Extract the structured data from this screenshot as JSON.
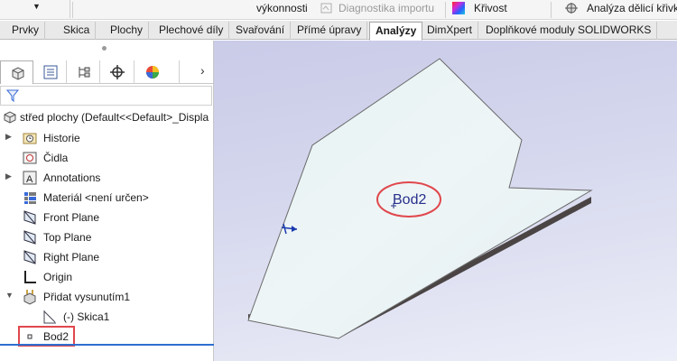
{
  "commandbar": {
    "items": [
      {
        "label": "výkonnosti",
        "disabled": false
      },
      {
        "label": "Diagnostika importu",
        "disabled": true
      },
      {
        "label": "Křivost",
        "disabled": false
      },
      {
        "label": "Analýza dělicí křivky",
        "disabled": false
      }
    ]
  },
  "tabs": [
    {
      "label": "Prvky",
      "active": false
    },
    {
      "label": "Skica",
      "active": false
    },
    {
      "label": "Plochy",
      "active": false
    },
    {
      "label": "Plechové díly",
      "active": false
    },
    {
      "label": "Svařování",
      "active": false
    },
    {
      "label": "Přímé úpravy",
      "active": false
    },
    {
      "label": "Analýzy",
      "active": true
    },
    {
      "label": "DimXpert",
      "active": false
    },
    {
      "label": "Doplňkové moduly SOLIDWORKS",
      "active": false
    }
  ],
  "panel": {
    "tab_icons": [
      "feature-manager-icon",
      "property-manager-icon",
      "configuration-manager-icon",
      "dimxpert-manager-icon",
      "display-manager-icon"
    ],
    "root_label": "střed plochy  (Default<<Default>_Displa",
    "tree": [
      {
        "label": "Historie",
        "icon": "history-folder-icon",
        "expandable": true,
        "indent": 0
      },
      {
        "label": "Čidla",
        "icon": "sensors-icon",
        "expandable": false,
        "indent": 0
      },
      {
        "label": "Annotations",
        "icon": "annotations-icon",
        "expandable": true,
        "indent": 0
      },
      {
        "label": "Materiál <není určen>",
        "icon": "material-icon",
        "expandable": false,
        "indent": 0
      },
      {
        "label": "Front Plane",
        "icon": "plane-icon",
        "expandable": false,
        "indent": 0
      },
      {
        "label": "Top Plane",
        "icon": "plane-icon",
        "expandable": false,
        "indent": 0
      },
      {
        "label": "Right Plane",
        "icon": "plane-icon",
        "expandable": false,
        "indent": 0
      },
      {
        "label": "Origin",
        "icon": "origin-icon",
        "expandable": false,
        "indent": 0
      },
      {
        "label": "Přidat vysunutím1",
        "icon": "extrude-icon",
        "expandable": true,
        "expanded": true,
        "indent": 0
      },
      {
        "label": "(-) Skica1",
        "icon": "sketch-icon",
        "expandable": false,
        "indent": 1
      },
      {
        "label": "Bod2",
        "icon": "point-icon",
        "expandable": false,
        "indent": 0,
        "highlighted": true
      }
    ]
  },
  "viewport": {
    "point_label": "Bod2",
    "highlight_color": "#e0474c",
    "label_color": "#27308c"
  }
}
